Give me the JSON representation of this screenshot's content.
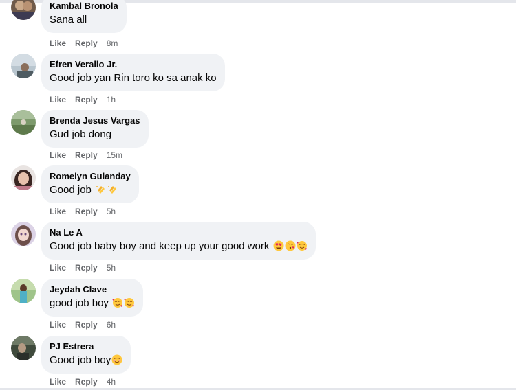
{
  "comments": [
    {
      "author": "Kambal Bronola",
      "text": "Sana all",
      "emojis": [],
      "like_label": "Like",
      "reply_label": "Reply",
      "time": "8m"
    },
    {
      "author": "Efren Verallo Jr.",
      "text": "Good job yan Rin toro ko sa anak ko",
      "emojis": [],
      "like_label": "Like",
      "reply_label": "Reply",
      "time": "1h"
    },
    {
      "author": "Brenda Jesus Vargas",
      "text": "Gud job dong",
      "emojis": [],
      "like_label": "Like",
      "reply_label": "Reply",
      "time": "15m"
    },
    {
      "author": "Romelyn Gulanday",
      "text": "Good job ",
      "emojis": [
        "clapping-hands-emoji",
        "clapping-hands-emoji"
      ],
      "like_label": "Like",
      "reply_label": "Reply",
      "time": "5h"
    },
    {
      "author": "Na Le A",
      "text": "Good job baby boy and keep up your good work ",
      "emojis": [
        "heart-eyes-emoji",
        "kissing-face-emoji",
        "smiling-face-with-hearts-emoji"
      ],
      "like_label": "Like",
      "reply_label": "Reply",
      "time": "5h"
    },
    {
      "author": "Jeydah Clave",
      "text": "good job boy ",
      "emojis": [
        "smiling-face-with-hearts-emoji",
        "smiling-face-with-hearts-emoji"
      ],
      "like_label": "Like",
      "reply_label": "Reply",
      "time": "6h"
    },
    {
      "author": "PJ Estrera",
      "text": "Good job boy",
      "emojis": [
        "smiling-face-emoji"
      ],
      "like_label": "Like",
      "reply_label": "Reply",
      "time": "4h"
    }
  ],
  "colors": {
    "bubble": "#f0f2f5",
    "meta_text": "#65676b",
    "primary_text": "#050505",
    "emoji_yellow": "#ffc83d",
    "emoji_heart": "#e0245e"
  }
}
